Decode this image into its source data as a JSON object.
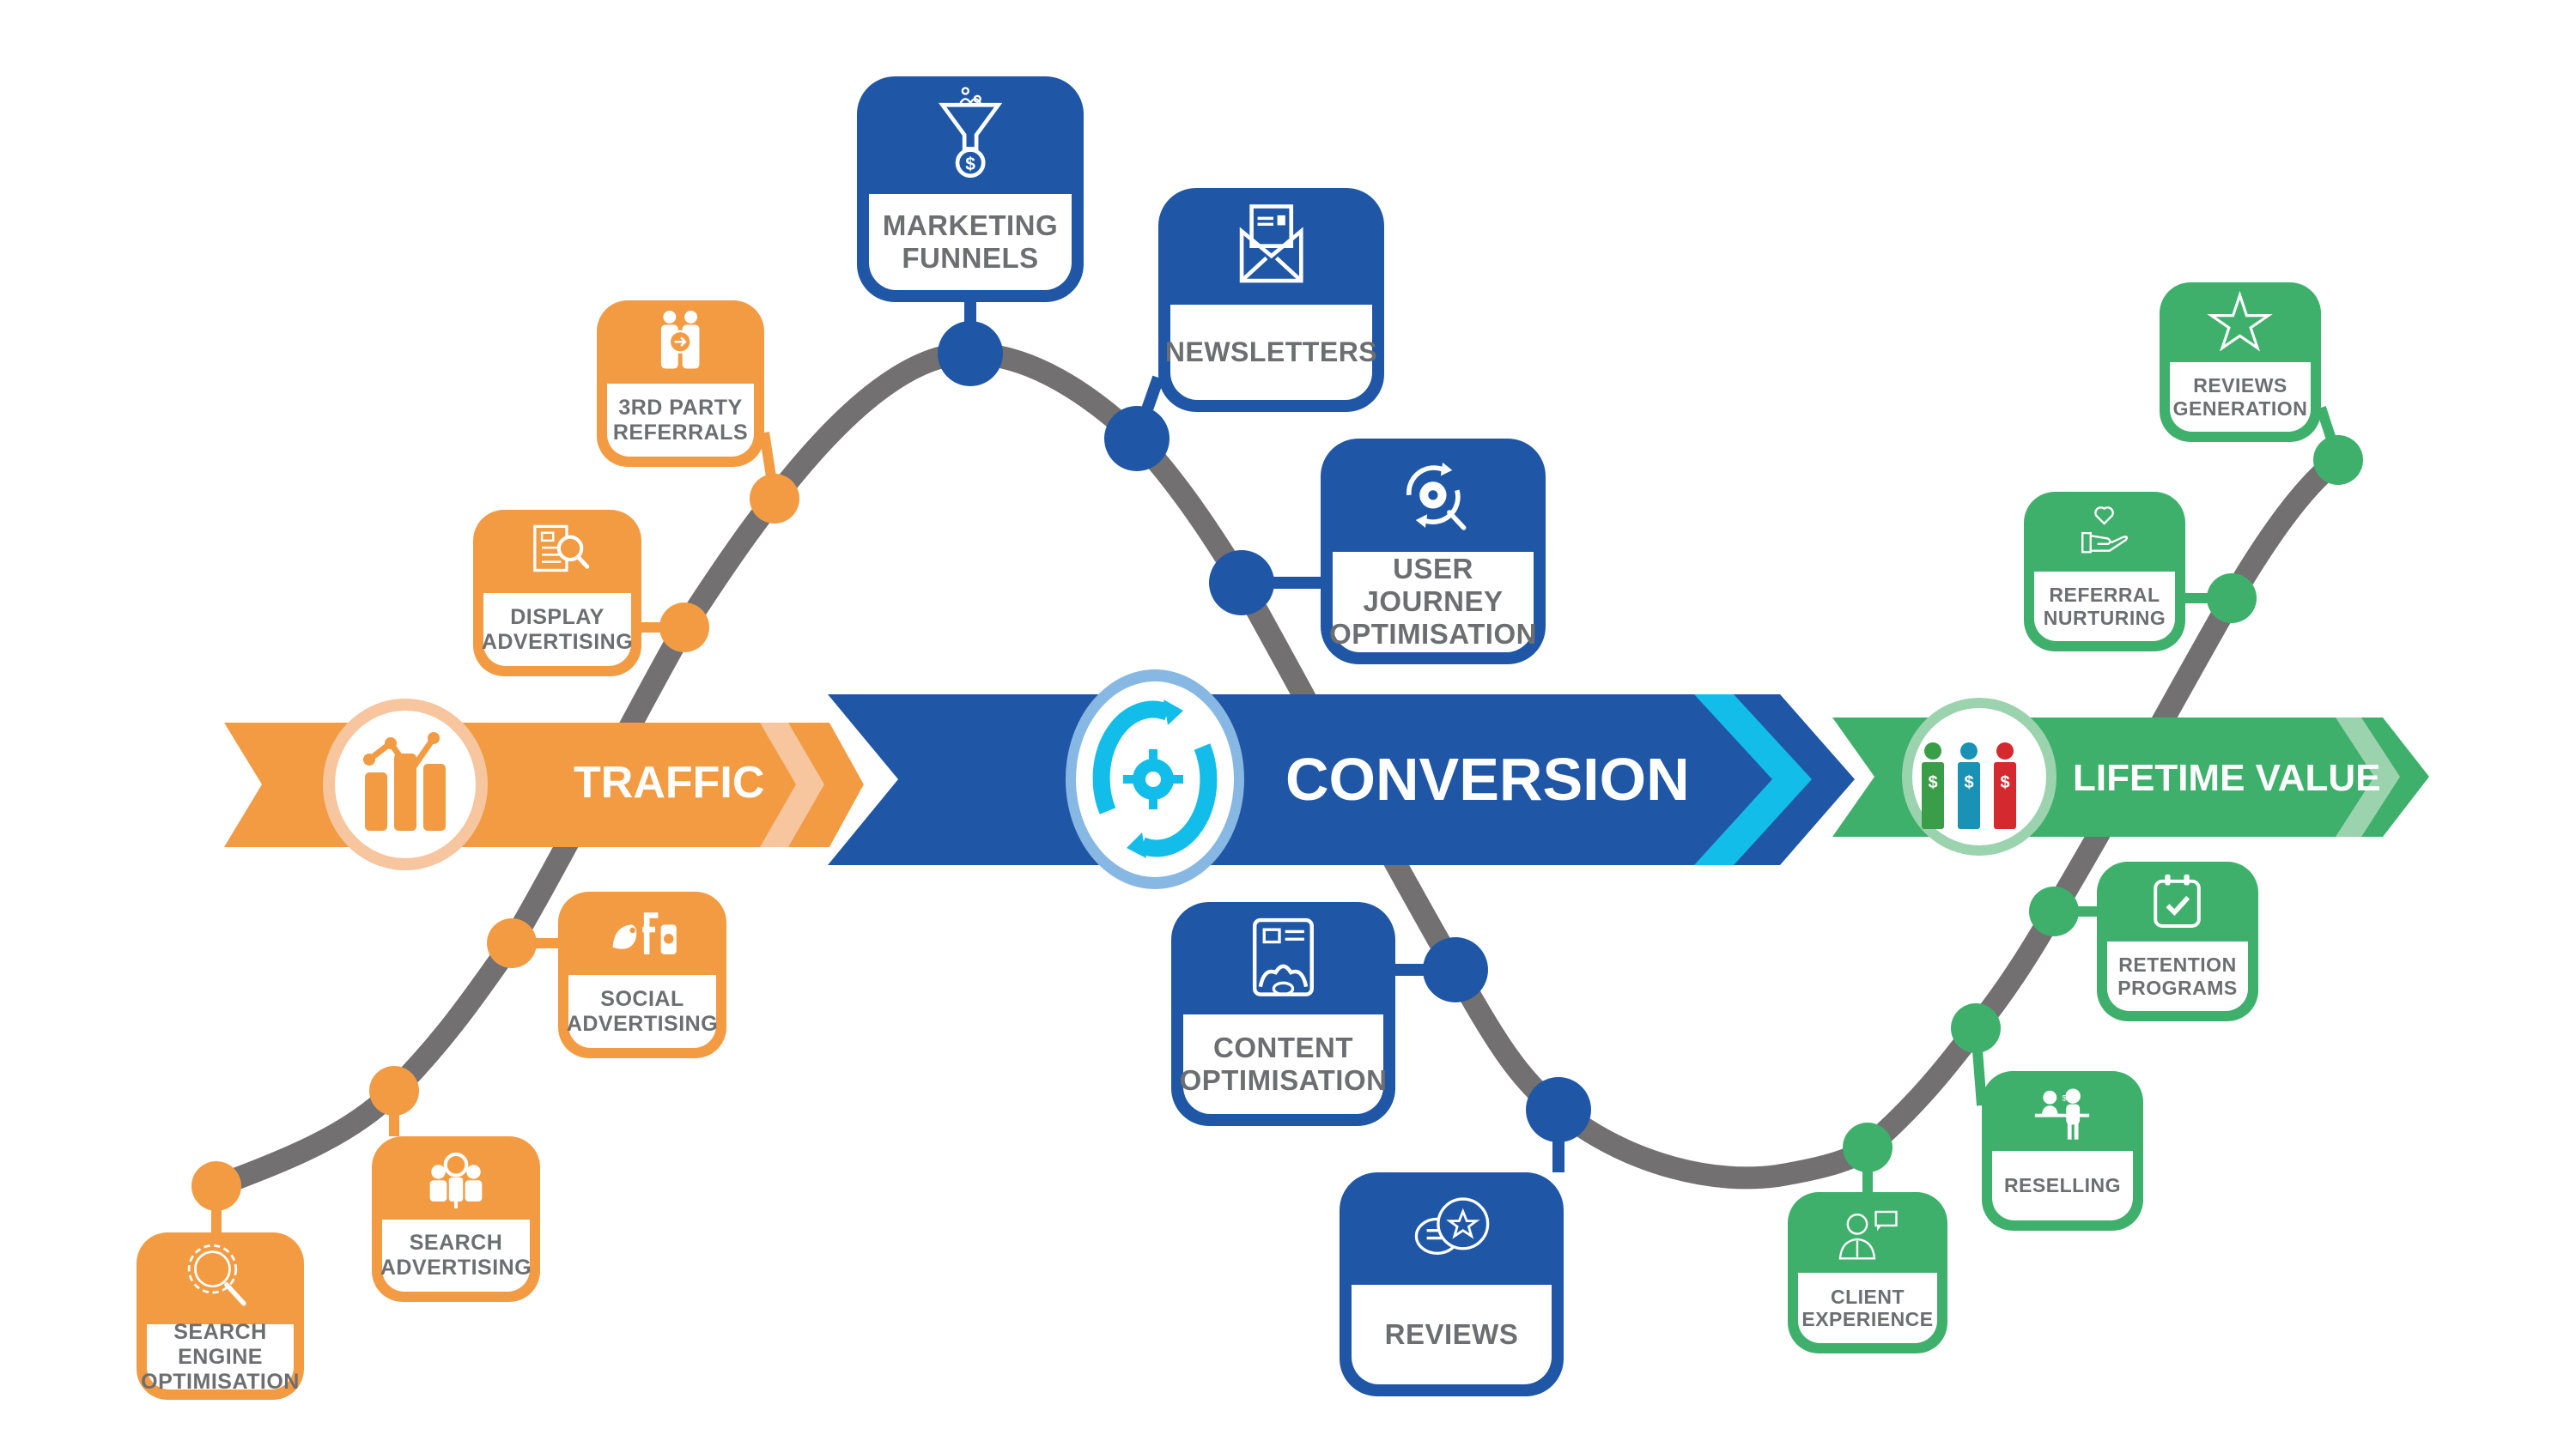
{
  "colors": {
    "traffic": "#f29b43",
    "traffic_light": "#f7c59e",
    "conversion": "#1f57a6",
    "conversion_accent": "#13bde9",
    "conversion_ring": "#87b8e3",
    "lifetime": "#3fb06b",
    "lifetime_light": "#9bd3ae",
    "path": "#727071",
    "label_text": "#6d6e71"
  },
  "stages": [
    {
      "id": "traffic",
      "label": "TRAFFIC",
      "icon": "trending-chart-icon"
    },
    {
      "id": "conversion",
      "label": "CONVERSION",
      "icon": "gear-refresh-icon"
    },
    {
      "id": "lifetime",
      "label": "LIFETIME VALUE",
      "icon": "customers-dollar-icon"
    }
  ],
  "cards": [
    {
      "stage": "traffic",
      "label": "SEARCH ENGINE\nOPTIMISATION",
      "icon": "seo-gear-magnifier-icon"
    },
    {
      "stage": "traffic",
      "label": "SEARCH\nADVERTISING",
      "icon": "people-search-icon"
    },
    {
      "stage": "traffic",
      "label": "SOCIAL\nADVERTISING",
      "icon": "social-media-icon"
    },
    {
      "stage": "traffic",
      "label": "DISPLAY\nADVERTISING",
      "icon": "newspaper-search-icon"
    },
    {
      "stage": "traffic",
      "label": "3RD PARTY\nREFERRALS",
      "icon": "referral-people-icon"
    },
    {
      "stage": "conversion",
      "label": "MARKETING\nFUNNELS",
      "icon": "funnel-dollar-icon"
    },
    {
      "stage": "conversion",
      "label": "NEWSLETTERS",
      "icon": "envelope-icon"
    },
    {
      "stage": "conversion",
      "label": "USER JOURNEY\nOPTIMISATION",
      "icon": "gear-cycle-search-icon"
    },
    {
      "stage": "conversion",
      "label": "CONTENT\nOPTIMISATION",
      "icon": "content-settings-icon"
    },
    {
      "stage": "conversion",
      "label": "REVIEWS",
      "icon": "review-bubbles-icon"
    },
    {
      "stage": "lifetime",
      "label": "CLIENT\nEXPERIENCE",
      "icon": "client-support-icon"
    },
    {
      "stage": "lifetime",
      "label": "RESELLING",
      "icon": "sales-counter-icon"
    },
    {
      "stage": "lifetime",
      "label": "RETENTION\nPROGRAMS",
      "icon": "calendar-check-icon"
    },
    {
      "stage": "lifetime",
      "label": "REFERRAL\nNURTURING",
      "icon": "heart-hand-icon"
    },
    {
      "stage": "lifetime",
      "label": "REVIEWS\nGENERATION",
      "icon": "star-icon"
    }
  ]
}
